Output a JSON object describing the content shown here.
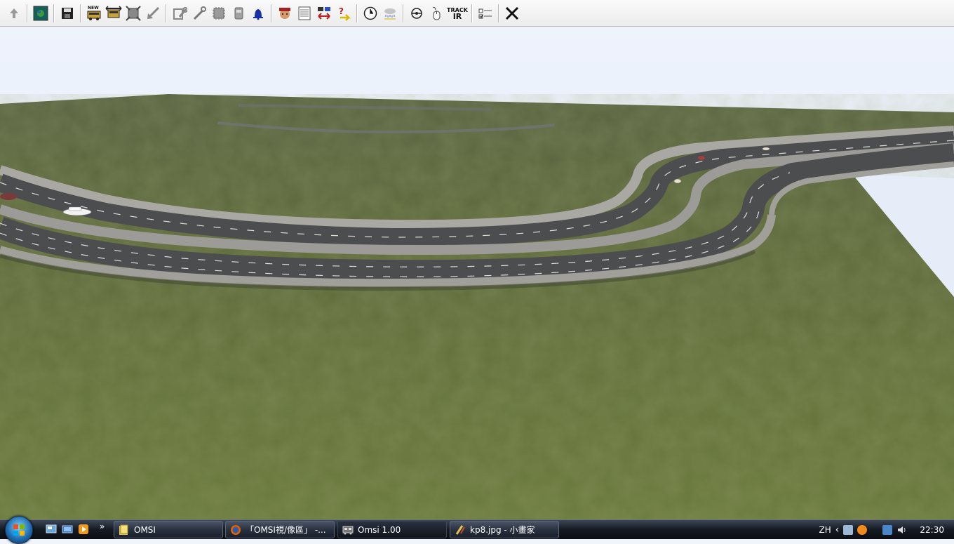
{
  "toolbar": {
    "buttons": [
      {
        "id": "up",
        "icon": "up-arrow-icon"
      },
      {
        "id": "map",
        "icon": "map-icon"
      },
      {
        "id": "save",
        "icon": "save-disk-icon"
      },
      {
        "id": "new-bus",
        "icon": "new-bus-icon",
        "label": "NEW"
      },
      {
        "id": "bus-move",
        "icon": "bus-move-icon"
      },
      {
        "id": "bus-frame",
        "icon": "bus-frame-icon"
      },
      {
        "id": "bus-arrow",
        "icon": "arrow-diagonal-icon"
      },
      {
        "id": "tools1",
        "icon": "wrench-gear-icon"
      },
      {
        "id": "tools2",
        "icon": "wrench-icon"
      },
      {
        "id": "chip",
        "icon": "chip-icon"
      },
      {
        "id": "ticket",
        "icon": "ticket-machine-icon"
      },
      {
        "id": "bell",
        "icon": "bell-icon"
      },
      {
        "id": "driver",
        "icon": "driver-face-icon"
      },
      {
        "id": "schedule",
        "icon": "schedule-list-icon"
      },
      {
        "id": "route",
        "icon": "route-exchange-icon"
      },
      {
        "id": "help",
        "icon": "help-question-icon"
      },
      {
        "id": "clock",
        "icon": "clock-icon"
      },
      {
        "id": "weather",
        "icon": "weather-icon"
      },
      {
        "id": "camera",
        "icon": "camera-view-icon"
      },
      {
        "id": "mouse",
        "icon": "mouse-icon"
      },
      {
        "id": "trackir",
        "icon": "trackir-icon",
        "label_top": "TRACK",
        "label_bottom": "IR"
      },
      {
        "id": "options",
        "icon": "options-checkbox-icon"
      },
      {
        "id": "close",
        "icon": "close-x-icon"
      }
    ]
  },
  "taskbar": {
    "tasks": [
      {
        "label": "OMSI",
        "icon": "folder-icon"
      },
      {
        "label": "「OMSI視/像區」 -...",
        "icon": "firefox-icon"
      },
      {
        "label": "Omsi 1.00",
        "icon": "omsi-app-icon",
        "active": true
      },
      {
        "label": "kp8.jpg - 小畫家",
        "icon": "paint-icon"
      }
    ],
    "quicklaunch_more": "»",
    "tray": {
      "language": "ZH",
      "chevron": "‹",
      "time": "22:30"
    }
  },
  "colors": {
    "sky_top": "#e9f0fb",
    "sky_bottom": "#dfe8f6",
    "grass": "#5c6a3a",
    "road": "#4b4c4e",
    "barrier": "#a3a29e",
    "taskbar": "#1b212c"
  }
}
